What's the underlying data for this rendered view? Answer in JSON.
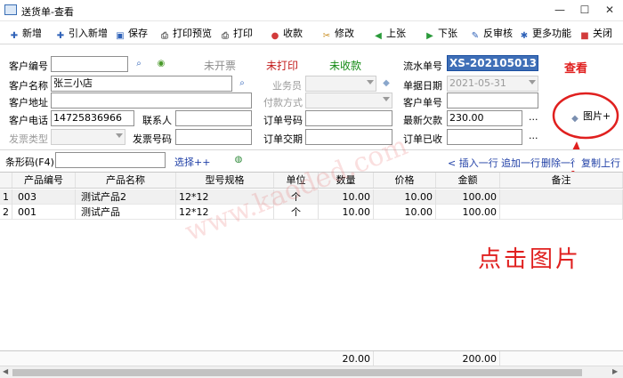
{
  "window": {
    "title": "送货单-查看",
    "minimize": "—",
    "maximize": "☐",
    "close": "✕"
  },
  "toolbar": {
    "new": "新增",
    "import_new": "引入新增",
    "save": "保存",
    "print_preview": "打印预览",
    "print": "打印",
    "collect": "收款",
    "edit": "修改",
    "prev": "上张",
    "next": "下张",
    "unaudit": "反审核",
    "more": "更多功能",
    "close": "关闭"
  },
  "form": {
    "customer_code_label": "客户编号",
    "customer_code": "",
    "customer_name_label": "客户名称",
    "customer_name": "张三小店",
    "customer_address_label": "客户地址",
    "customer_address": "",
    "customer_phone_label": "客户电话",
    "customer_phone": "14725836966",
    "contact_label": "联系人",
    "contact": "",
    "invoice_type_label": "发票类型",
    "invoice_type": "",
    "invoice_no_label": "发票号码",
    "invoice_no": "",
    "status_invoice": "未开票",
    "status_print": "未打印",
    "status_collect": "未收款",
    "salesman_label": "业务员",
    "salesman": "",
    "payment_label": "付款方式",
    "payment": "",
    "order_no_label": "订单号码",
    "order_no": "",
    "order_date_label": "订单交期",
    "order_date": "",
    "serial_label": "流水单号",
    "serial": "XS-202105013",
    "doc_date_label": "单据日期",
    "doc_date": "2021-05-31",
    "cust_order_label": "客户单号",
    "cust_order": "",
    "latest_debt_label": "最新欠款",
    "latest_debt": "230.00",
    "order_received_label": "订单已收",
    "order_received": "",
    "ellipsis": "...",
    "picture_button": "图片+"
  },
  "barcode": {
    "label": "条形码(F4)",
    "value": "",
    "select": "选择++",
    "insert_row": "< 插入一行",
    "append_row": "追加一行",
    "delete_row": "删除一行",
    "copy_row": "复制上行"
  },
  "table": {
    "headers": [
      "产品编号",
      "产品名称",
      "型号规格",
      "单位",
      "数量",
      "价格",
      "金额",
      "备注"
    ],
    "rows": [
      {
        "idx": "1",
        "code": "003",
        "name": "测试产品2",
        "spec": "12*12",
        "unit": "个",
        "qty": "10.00",
        "price": "10.00",
        "amount": "100.00",
        "note": ""
      },
      {
        "idx": "2",
        "code": "001",
        "name": "测试产品",
        "spec": "12*12",
        "unit": "个",
        "qty": "10.00",
        "price": "10.00",
        "amount": "100.00",
        "note": ""
      }
    ],
    "total_qty": "20.00",
    "total_amount": "200.00"
  },
  "annotations": {
    "top": "查看",
    "bottom": "点击图片",
    "watermark": "www.kaoded.com"
  }
}
